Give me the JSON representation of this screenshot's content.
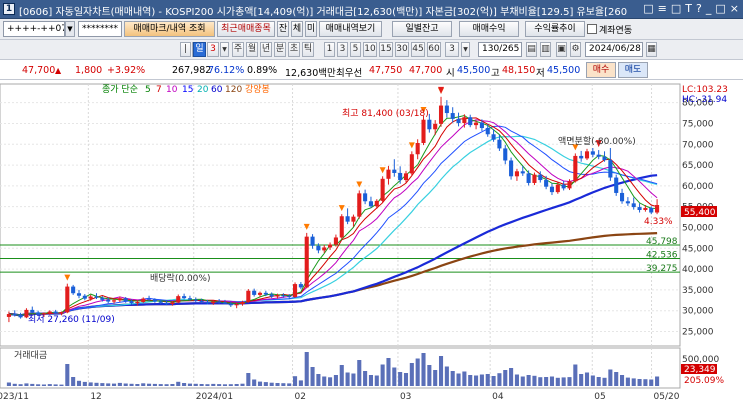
{
  "title_bar": {
    "code": "[0606]",
    "text": "자동일자차트(매매내역) - KOSPI200 시가총액[14,409(억)] 거래대금[12,630(백만)] 자본금[302(억)] 부채비율[129.5] 유보율[260",
    "controls": [
      "□",
      "≡",
      "□",
      "T",
      "?",
      "_",
      "□",
      "×"
    ]
  },
  "toolbar1": {
    "code_value": "++++-++07",
    "password_value": "********",
    "buttons": [
      "매매마크/내역 조회",
      "최근매매종목",
      "잔",
      "체",
      "미",
      "매매내역보기",
      "일별잔고",
      "매매수익",
      "수익률추이"
    ],
    "checkbox_label": "계좌연동"
  },
  "toolbar2": {
    "left_icons": [
      "|",
      "↺"
    ],
    "period_tabs": [
      "일",
      "3",
      "주",
      "월",
      "년",
      "분",
      "초",
      "틱"
    ],
    "minute_options": [
      "1",
      "3",
      "5",
      "10",
      "15",
      "30",
      "45",
      "60",
      "3"
    ],
    "count_value": "130/265",
    "date_value": "2024/06/28"
  },
  "quote": {
    "price": "47,700",
    "change": "1,800",
    "change_pct": "+3.92%",
    "volume": "267,982",
    "vol_ratio": "76.12%",
    "turnover": "0.89%",
    "amount": "12,630백만",
    "best_ask_label": "최우선",
    "best_ask": "47,750",
    "best_bid": "47,700",
    "open_label": "시",
    "open": "45,500",
    "high_label": "고",
    "high": "48,150",
    "low_label": "저",
    "low": "45,500",
    "buy_btn": "매수",
    "sell_btn": "매도"
  },
  "chart_data": {
    "type": "candlestick",
    "legend": [
      "종가 단순",
      "5",
      "7",
      "10",
      "15",
      "20",
      "60",
      "120",
      "강양봉"
    ],
    "legend_colors": [
      "#008000",
      "#008000",
      "#d40000",
      "#c000c0",
      "#0000ff",
      "#00c0c0",
      "#0000cc",
      "#8b4513",
      "#ff6600"
    ],
    "lc_label": "LC:103.23",
    "hc_label": "HC:-31.94",
    "y_ticks": [
      "80,000",
      "75,000",
      "70,000",
      "65,000",
      "60,000",
      "55,000",
      "50,000",
      "45,000",
      "40,000",
      "35,000",
      "30,000",
      "25,000"
    ],
    "y_range": [
      22000,
      84000
    ],
    "current_price_label": "55,400",
    "current_pct_label": "4.33%",
    "levels": [
      {
        "label": "45,798",
        "value": 45798
      },
      {
        "label": "42,536",
        "value": 42536
      },
      {
        "label": "39,275",
        "value": 39275
      }
    ],
    "annotations": {
      "high": "최고 81,400 (03/18)",
      "low": "최저 27,260 (11/09)",
      "split": "액면분할(-80.00%)",
      "dividend": "배당락(0.00%)"
    },
    "x_labels": [
      "2023/11",
      "12",
      "2024/01",
      "02",
      "03",
      "04",
      "05",
      "05/20"
    ],
    "x_label_dates": [
      "2023-11-01",
      "2023-12-01",
      "2024-01-02",
      "2024-02-01",
      "2024-03-04",
      "2024-04-01",
      "2024-05-02",
      "2024-05-20"
    ],
    "volume_panel": {
      "title": "거래대금",
      "y_ticks": [
        "500,000",
        "23,349",
        "205.09%"
      ]
    },
    "candles": [
      [
        28500,
        29800,
        27260,
        29200
      ],
      [
        29200,
        30100,
        28600,
        29000
      ],
      [
        29000,
        29500,
        28100,
        28400
      ],
      [
        28400,
        30600,
        28200,
        30200
      ],
      [
        30200,
        31000,
        29400,
        29600
      ],
      [
        29600,
        30000,
        28800,
        29100
      ],
      [
        29100,
        29600,
        28500,
        29400
      ],
      [
        29400,
        30100,
        29000,
        29800
      ],
      [
        29800,
        30200,
        29100,
        29300
      ],
      [
        29300,
        29800,
        28900,
        29600
      ],
      [
        29600,
        36500,
        29400,
        35800
      ],
      [
        35800,
        36200,
        33800,
        34200
      ],
      [
        34200,
        35000,
        33000,
        33600
      ],
      [
        33600,
        34000,
        32500,
        32900
      ],
      [
        32900,
        33800,
        32400,
        33400
      ],
      [
        33400,
        34200,
        32800,
        33100
      ],
      [
        33100,
        33500,
        32200,
        32600
      ],
      [
        32600,
        33200,
        31800,
        32200
      ],
      [
        32200,
        32900,
        31700,
        32500
      ],
      [
        32500,
        33400,
        32100,
        33000
      ],
      [
        33000,
        33300,
        31900,
        32300
      ],
      [
        32300,
        32800,
        31500,
        31800
      ],
      [
        31800,
        32500,
        31300,
        32100
      ],
      [
        32100,
        33200,
        31900,
        32900
      ],
      [
        32900,
        33600,
        32300,
        32700
      ],
      [
        32700,
        33000,
        31900,
        32200
      ],
      [
        32200,
        32700,
        31600,
        31900
      ],
      [
        31900,
        32400,
        31300,
        31600
      ],
      [
        31600,
        32300,
        31200,
        32000
      ],
      [
        32000,
        33900,
        31800,
        33500
      ],
      [
        33500,
        34100,
        32700,
        33000
      ],
      [
        33000,
        33600,
        32400,
        32700
      ],
      [
        32700,
        33200,
        32000,
        32400
      ],
      [
        32400,
        32900,
        31800,
        32100
      ],
      [
        32100,
        32600,
        31500,
        31800
      ],
      [
        31800,
        32500,
        31400,
        32200
      ],
      [
        32200,
        32800,
        31700,
        32000
      ],
      [
        32000,
        32600,
        31500,
        31700
      ],
      [
        31700,
        32200,
        30900,
        31300
      ],
      [
        31300,
        31900,
        30600,
        31600
      ],
      [
        31600,
        32400,
        31200,
        32100
      ],
      [
        32100,
        35200,
        31900,
        34800
      ],
      [
        34800,
        35300,
        33400,
        33800
      ],
      [
        33800,
        34600,
        33300,
        34300
      ],
      [
        34300,
        34800,
        33500,
        33900
      ],
      [
        33900,
        34400,
        33000,
        33400
      ],
      [
        33400,
        34100,
        32900,
        33700
      ],
      [
        33700,
        34200,
        33100,
        33500
      ],
      [
        33500,
        34000,
        32900,
        33300
      ],
      [
        33300,
        36800,
        33100,
        36400
      ],
      [
        36400,
        36900,
        35200,
        35600
      ],
      [
        35600,
        48700,
        35400,
        47800
      ],
      [
        47800,
        48400,
        44900,
        45600
      ],
      [
        45600,
        46200,
        43800,
        44500
      ],
      [
        44500,
        45800,
        43900,
        45200
      ],
      [
        45200,
        46400,
        44600,
        45900
      ],
      [
        45900,
        48300,
        45400,
        47600
      ],
      [
        47600,
        53200,
        47200,
        52700
      ],
      [
        52700,
        54600,
        50800,
        51400
      ],
      [
        51400,
        53100,
        50200,
        52600
      ],
      [
        52600,
        58900,
        52100,
        58200
      ],
      [
        58200,
        59100,
        55600,
        56300
      ],
      [
        56300,
        57400,
        54700,
        55100
      ],
      [
        55100,
        56800,
        54500,
        56400
      ],
      [
        56400,
        62300,
        56000,
        61700
      ],
      [
        61700,
        64800,
        60300,
        63900
      ],
      [
        63900,
        66400,
        62200,
        63100
      ],
      [
        63100,
        64700,
        60500,
        61400
      ],
      [
        61400,
        63600,
        60800,
        63000
      ],
      [
        63000,
        68300,
        62600,
        67600
      ],
      [
        67600,
        71200,
        66400,
        70300
      ],
      [
        70300,
        76800,
        69800,
        75900
      ],
      [
        75900,
        77300,
        72800,
        73600
      ],
      [
        73600,
        75800,
        72200,
        74900
      ],
      [
        74900,
        81400,
        74200,
        79300
      ],
      [
        79300,
        80600,
        76400,
        77500
      ],
      [
        77500,
        78900,
        75200,
        76100
      ],
      [
        76100,
        77600,
        74300,
        75100
      ],
      [
        75100,
        77200,
        74000,
        76500
      ],
      [
        76500,
        77100,
        74100,
        74600
      ],
      [
        74600,
        75800,
        73600,
        75200
      ],
      [
        75200,
        76000,
        73200,
        73900
      ],
      [
        73900,
        74800,
        71800,
        72400
      ],
      [
        72400,
        73600,
        70600,
        71100
      ],
      [
        71100,
        72300,
        68400,
        69000
      ],
      [
        69000,
        69800,
        65200,
        66100
      ],
      [
        66100,
        66800,
        61500,
        62300
      ],
      [
        62300,
        64100,
        61200,
        63500
      ],
      [
        63500,
        64800,
        62400,
        63000
      ],
      [
        63000,
        63700,
        60100,
        60700
      ],
      [
        60700,
        63200,
        60200,
        62700
      ],
      [
        62700,
        63500,
        60800,
        61400
      ],
      [
        61400,
        62400,
        59200,
        59800
      ],
      [
        59800,
        60600,
        57800,
        58500
      ],
      [
        58500,
        60800,
        58100,
        60300
      ],
      [
        60300,
        61200,
        58900,
        59400
      ],
      [
        59400,
        61600,
        59000,
        61100
      ],
      [
        61100,
        67800,
        60800,
        67200
      ],
      [
        67200,
        68400,
        65800,
        66600
      ],
      [
        66600,
        68900,
        66200,
        68300
      ],
      [
        68300,
        69100,
        66900,
        67500
      ],
      [
        67500,
        68600,
        66400,
        67000
      ],
      [
        67000,
        68300,
        65800,
        66200
      ],
      [
        66200,
        69100,
        61200,
        62000
      ],
      [
        62000,
        62700,
        57600,
        58300
      ],
      [
        58300,
        59300,
        55700,
        56300
      ],
      [
        56300,
        57300,
        55200,
        55800
      ],
      [
        55800,
        57200,
        54300,
        54900
      ],
      [
        54900,
        55800,
        53600,
        54200
      ],
      [
        54200,
        55400,
        53800,
        54700
      ],
      [
        54700,
        55100,
        53200,
        53600
      ],
      [
        53600,
        56800,
        53200,
        55400
      ]
    ],
    "volumes": [
      3500,
      2200,
      1800,
      2600,
      2100,
      1700,
      1500,
      1900,
      1600,
      1400,
      22000,
      9000,
      5200,
      4100,
      3600,
      3200,
      2900,
      2600,
      2400,
      3100,
      2500,
      2200,
      2000,
      2700,
      2300,
      2100,
      1900,
      1800,
      2000,
      4200,
      3000,
      2400,
      2200,
      2000,
      1800,
      2100,
      1900,
      1700,
      1800,
      2000,
      2300,
      13000,
      6500,
      4400,
      3900,
      3300,
      3000,
      2800,
      2600,
      9800,
      5600,
      34000,
      19000,
      12000,
      9500,
      8700,
      11000,
      21000,
      13500,
      12500,
      26000,
      15000,
      11000,
      10500,
      21500,
      28000,
      18500,
      14000,
      13000,
      23000,
      27500,
      33000,
      21000,
      16000,
      30000,
      19500,
      15000,
      12500,
      14500,
      11000,
      10500,
      11500,
      12000,
      10000,
      12800,
      16000,
      18000,
      11500,
      9500,
      11000,
      10200,
      8800,
      9000,
      9500,
      8200,
      8600,
      8900,
      21500,
      12000,
      13500,
      10500,
      9000,
      8200,
      16500,
      14000,
      11000,
      8400,
      7600,
      7000,
      6800,
      6500,
      9500
    ]
  }
}
